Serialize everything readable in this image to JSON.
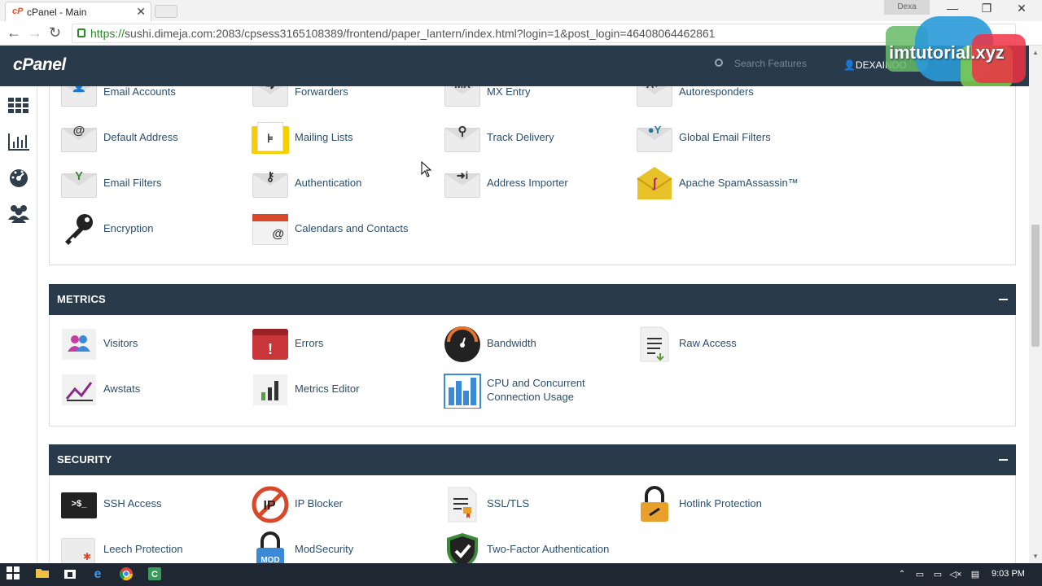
{
  "browser": {
    "tab_title": "cPanel - Main",
    "tab_favicon": "cP",
    "profile_name": "Dexa",
    "url_scheme": "https://",
    "url_rest": "sushi.dimeja.com:2083/cpsess3165108389/frontend/paper_lantern/index.html?login=1&post_login=46408064462861"
  },
  "header": {
    "logo": "cPanel",
    "search_placeholder": "Search Features",
    "user": "DEXAINDO",
    "watermark": "imtutorial.xyz"
  },
  "email_items": [
    {
      "label": "Email Accounts",
      "icon": "email-accounts-icon",
      "glyph": "👤"
    },
    {
      "label": "Forwarders",
      "icon": "forwarders-icon",
      "glyph": "➜"
    },
    {
      "label": "MX Entry",
      "icon": "mx-entry-icon",
      "glyph": "MX"
    },
    {
      "label": "Autoresponders",
      "icon": "autoresponders-icon",
      "glyph": "A↩"
    },
    {
      "label": "Default Address",
      "icon": "default-address-icon",
      "glyph": "@"
    },
    {
      "label": "Mailing Lists",
      "icon": "mailing-lists-icon",
      "glyph": "⊧"
    },
    {
      "label": "Track Delivery",
      "icon": "track-delivery-icon",
      "glyph": "⚲"
    },
    {
      "label": "Global Email Filters",
      "icon": "global-email-filters-icon",
      "glyph": "●Y"
    },
    {
      "label": "Email Filters",
      "icon": "email-filters-icon",
      "glyph": "Y"
    },
    {
      "label": "Authentication",
      "icon": "authentication-icon",
      "glyph": "⚷"
    },
    {
      "label": "Address Importer",
      "icon": "address-importer-icon",
      "glyph": "➜i"
    },
    {
      "label": "Apache SpamAssassin™",
      "icon": "spamassassin-icon",
      "glyph": "ʃ"
    },
    {
      "label": "Encryption",
      "icon": "encryption-key-icon",
      "glyph": "🔑"
    },
    {
      "label": "Calendars and Contacts",
      "icon": "calendars-icon",
      "glyph": "@"
    }
  ],
  "metrics": {
    "title": "METRICS",
    "items": [
      {
        "label": "Visitors",
        "icon": "visitors-icon"
      },
      {
        "label": "Errors",
        "icon": "errors-icon"
      },
      {
        "label": "Bandwidth",
        "icon": "bandwidth-icon"
      },
      {
        "label": "Raw Access",
        "icon": "raw-access-icon"
      },
      {
        "label": "Awstats",
        "icon": "awstats-icon"
      },
      {
        "label": "Metrics Editor",
        "icon": "metrics-editor-icon"
      },
      {
        "label": "CPU and Concurrent Connection Usage",
        "icon": "cpu-usage-icon"
      }
    ]
  },
  "security": {
    "title": "SECURITY",
    "items": [
      {
        "label": "SSH Access",
        "icon": "ssh-access-icon",
        "glyph": ">$_"
      },
      {
        "label": "IP Blocker",
        "icon": "ip-blocker-icon",
        "glyph": "IP"
      },
      {
        "label": "SSL/TLS",
        "icon": "ssl-tls-icon",
        "glyph": "≡"
      },
      {
        "label": "Hotlink Protection",
        "icon": "hotlink-protection-icon",
        "glyph": "🔒"
      },
      {
        "label": "Leech Protection",
        "icon": "leech-protection-icon",
        "glyph": "✱"
      },
      {
        "label": "ModSecurity",
        "icon": "modsecurity-icon",
        "glyph": "MOD"
      },
      {
        "label": "Two-Factor Authentication",
        "icon": "two-factor-icon",
        "glyph": "✔"
      }
    ]
  },
  "taskbar": {
    "time": "9:03 PM"
  },
  "colors": {
    "header_bg": "#293a4a",
    "link": "#2c4e6e",
    "taskbar": "#1f2732"
  }
}
